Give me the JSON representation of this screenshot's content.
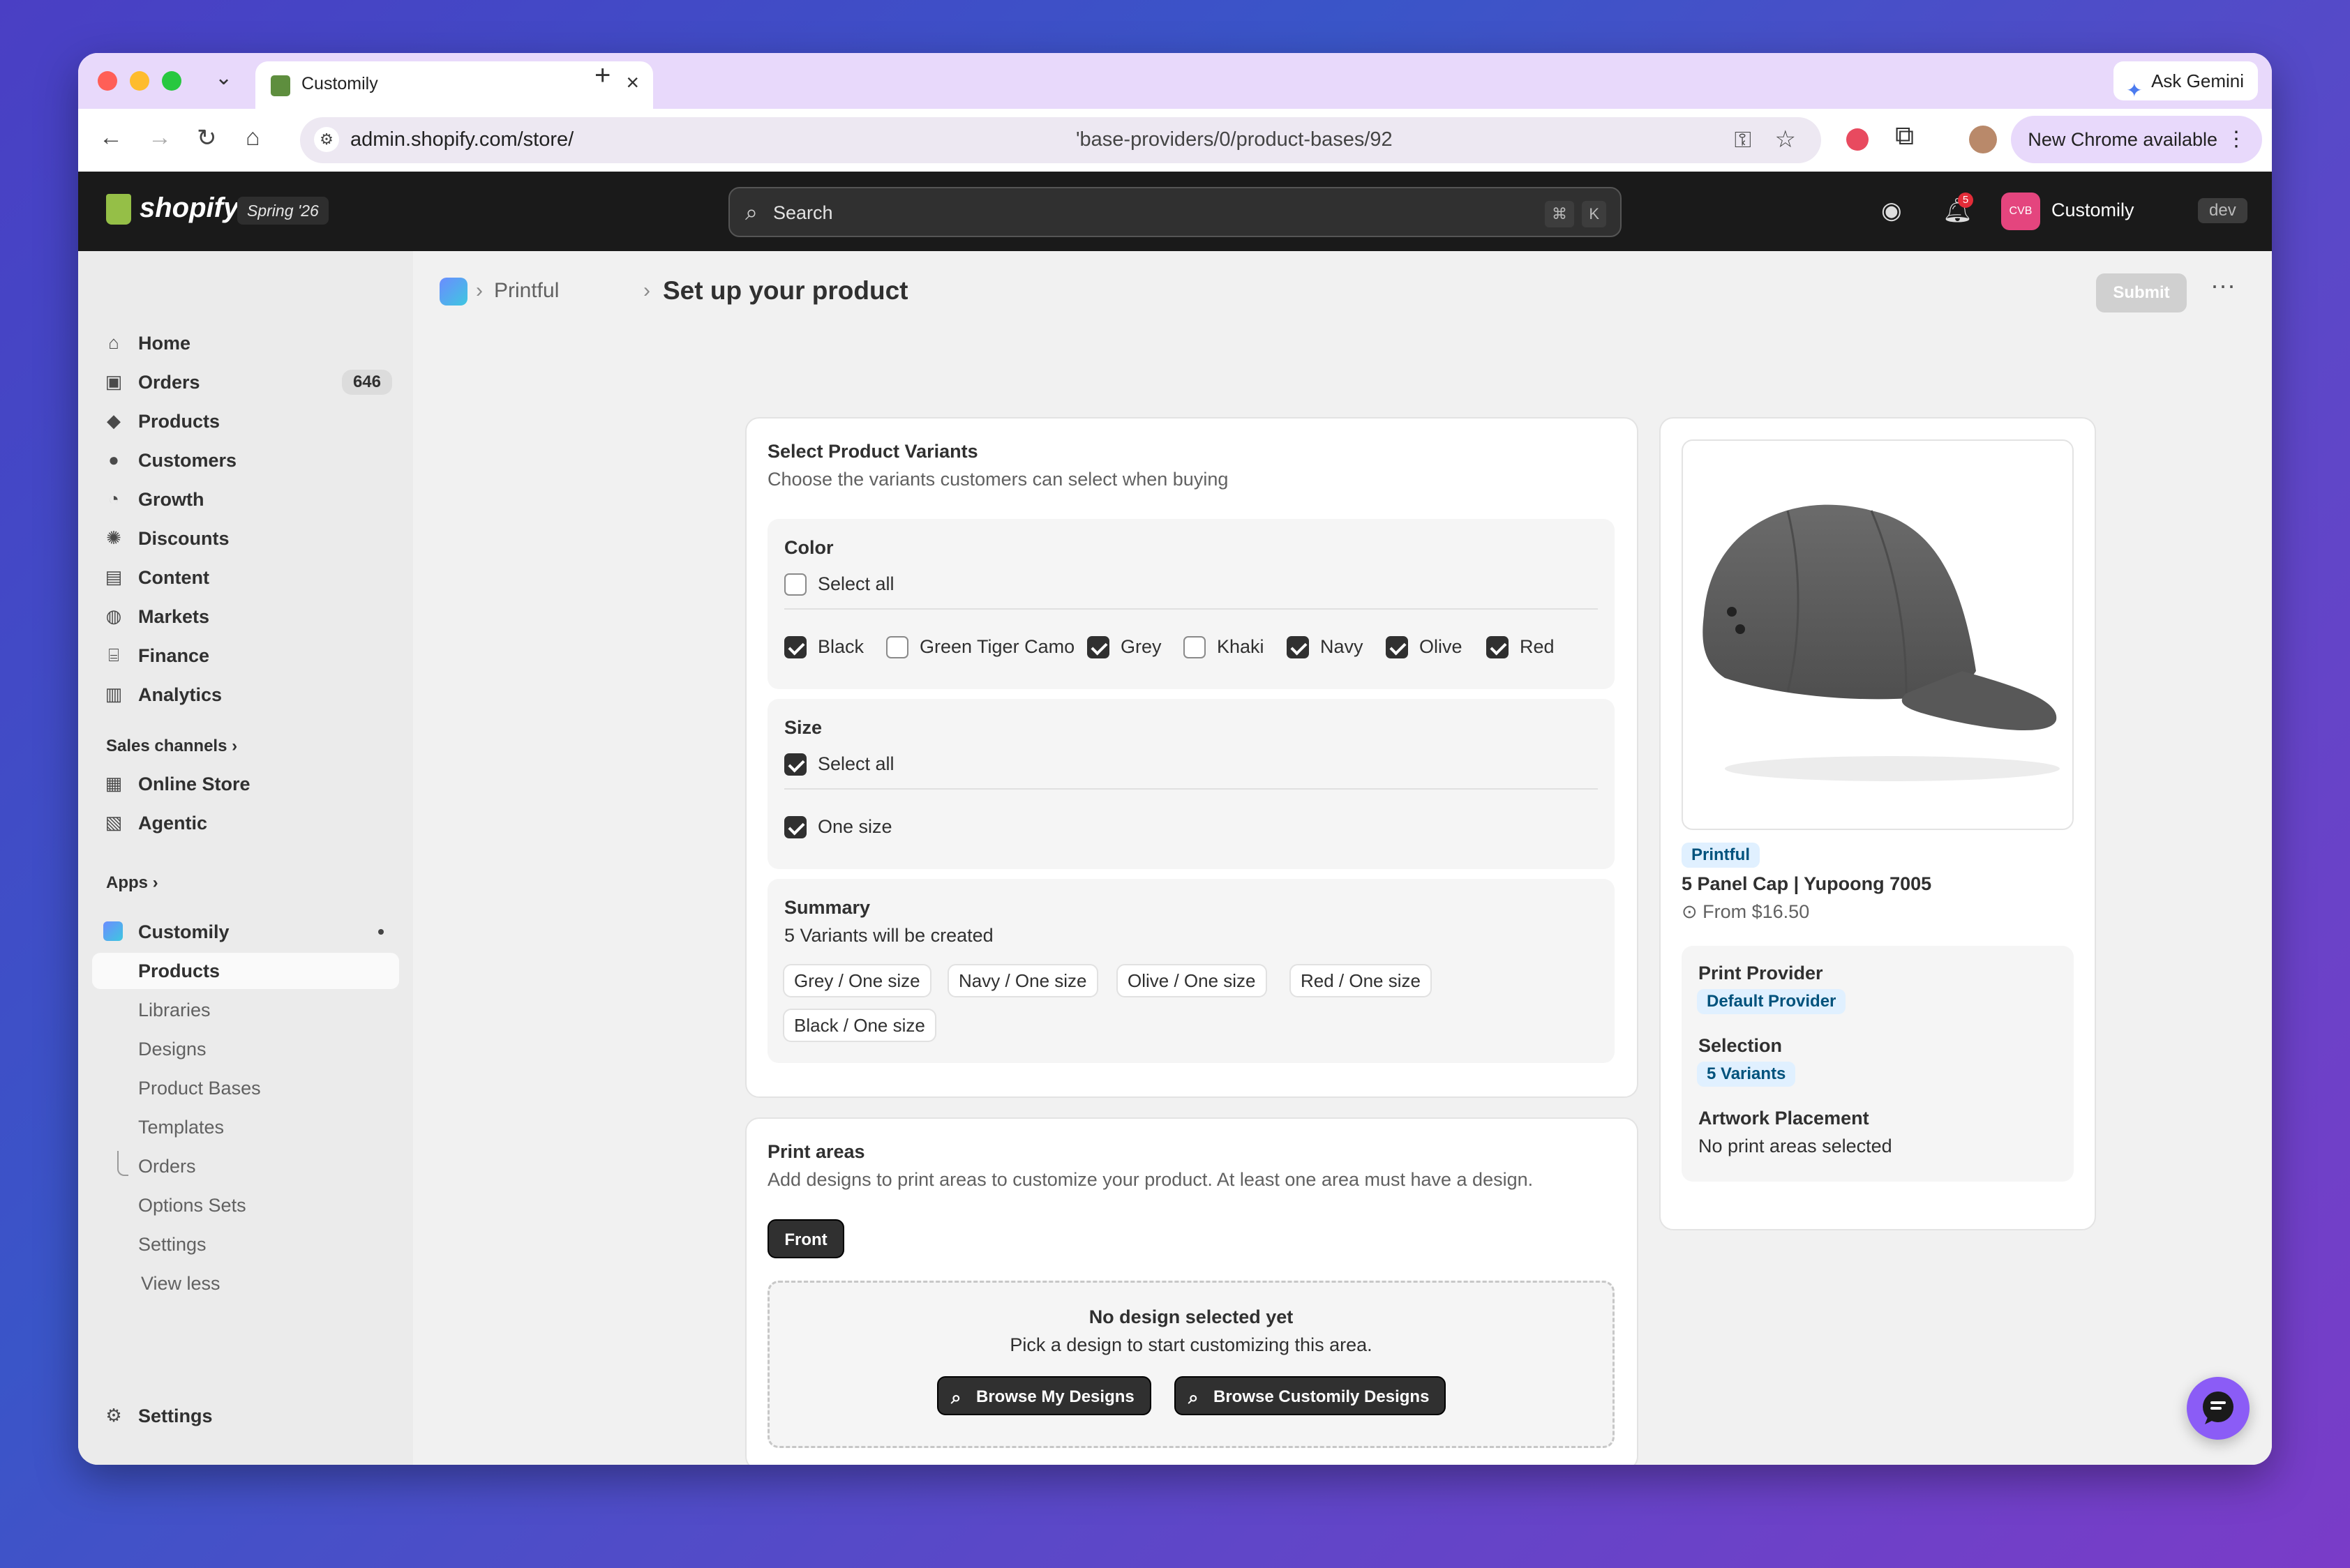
{
  "browser": {
    "tab_title": "Customily",
    "url_host": "admin.shopify.com/store/",
    "url_path": "'base-providers/0/product-bases/92",
    "ask_gemini": "Ask Gemini",
    "new_chrome": "New Chrome available"
  },
  "header": {
    "logo": "shopify",
    "edition": "Spring '26",
    "search_placeholder": "Search",
    "shortcut_cmd": "⌘",
    "shortcut_k": "K",
    "notification_count": "5",
    "store_initials": "CVB",
    "store_name": "Customily",
    "env_badge": "dev"
  },
  "sidebar": {
    "items": [
      {
        "label": "Home",
        "icon": "home-icon"
      },
      {
        "label": "Orders",
        "icon": "inbox-icon",
        "count": "646"
      },
      {
        "label": "Products",
        "icon": "tag-icon"
      },
      {
        "label": "Customers",
        "icon": "person-icon"
      },
      {
        "label": "Growth",
        "icon": "gauge-icon"
      },
      {
        "label": "Discounts",
        "icon": "discount-icon"
      },
      {
        "label": "Content",
        "icon": "content-icon"
      },
      {
        "label": "Markets",
        "icon": "globe-icon"
      },
      {
        "label": "Finance",
        "icon": "bank-icon"
      },
      {
        "label": "Analytics",
        "icon": "bar-chart-icon"
      }
    ],
    "sales_channels_heading": "Sales channels",
    "sales_channels": [
      {
        "label": "Online Store"
      },
      {
        "label": "Agentic"
      }
    ],
    "apps_heading": "Apps",
    "app_name": "Customily",
    "app_subitems": [
      "Products",
      "Libraries",
      "Designs",
      "Product Bases",
      "Templates",
      "Orders",
      "Options Sets",
      "Settings",
      "View less"
    ],
    "settings": "Settings"
  },
  "page": {
    "breadcrumb": "Printful",
    "title": "Set up your product",
    "submit": "Submit"
  },
  "variants_card": {
    "title": "Select Product Variants",
    "subtitle": "Choose the variants customers can select when buying",
    "color_heading": "Color",
    "color_select_all": "Select all",
    "colors": [
      {
        "label": "Black",
        "checked": true
      },
      {
        "label": "Green Tiger Camo",
        "checked": false
      },
      {
        "label": "Grey",
        "checked": true
      },
      {
        "label": "Khaki",
        "checked": false
      },
      {
        "label": "Navy",
        "checked": true
      },
      {
        "label": "Olive",
        "checked": true
      },
      {
        "label": "Red",
        "checked": true
      }
    ],
    "size_heading": "Size",
    "size_select_all": "Select all",
    "sizes": [
      {
        "label": "One size",
        "checked": true
      }
    ],
    "summary_heading": "Summary",
    "summary_text": "5 Variants will be created",
    "summary_chips": [
      "Grey / One size",
      "Navy / One size",
      "Olive / One size",
      "Red / One size",
      "Black / One size"
    ]
  },
  "print_areas": {
    "title": "Print areas",
    "subtitle": "Add designs to print areas to customize your product. At least one area must have a design.",
    "tab": "Front",
    "empty_title": "No design selected yet",
    "empty_sub": "Pick a design to start customizing this area.",
    "browse_mine": "Browse My Designs",
    "browse_customily": "Browse Customily Designs"
  },
  "product_card": {
    "provider_badge": "Printful",
    "name": "5 Panel Cap | Yupoong 7005",
    "price": "From $16.50",
    "print_provider_label": "Print Provider",
    "print_provider_value": "Default Provider",
    "selection_label": "Selection",
    "selection_value": "5 Variants",
    "artwork_label": "Artwork Placement",
    "artwork_value": "No print areas selected"
  },
  "colors": {
    "accent": "#303030",
    "badge_bg": "#e0f0ff",
    "chat": "#8b5cf6"
  }
}
